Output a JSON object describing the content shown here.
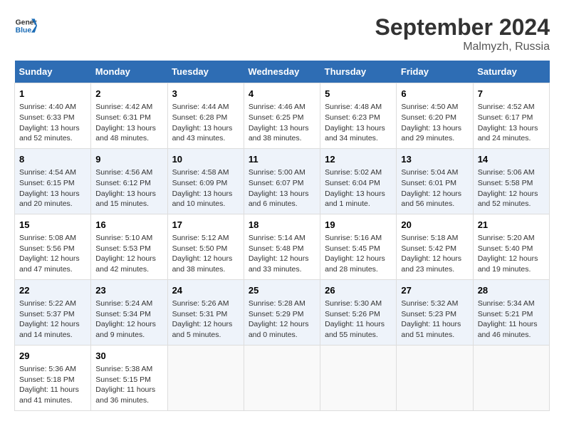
{
  "header": {
    "logo_line1": "General",
    "logo_line2": "Blue",
    "month": "September 2024",
    "location": "Malmyzh, Russia"
  },
  "weekdays": [
    "Sunday",
    "Monday",
    "Tuesday",
    "Wednesday",
    "Thursday",
    "Friday",
    "Saturday"
  ],
  "weeks": [
    [
      {
        "day": "1",
        "info": "Sunrise: 4:40 AM\nSunset: 6:33 PM\nDaylight: 13 hours\nand 52 minutes."
      },
      {
        "day": "2",
        "info": "Sunrise: 4:42 AM\nSunset: 6:31 PM\nDaylight: 13 hours\nand 48 minutes."
      },
      {
        "day": "3",
        "info": "Sunrise: 4:44 AM\nSunset: 6:28 PM\nDaylight: 13 hours\nand 43 minutes."
      },
      {
        "day": "4",
        "info": "Sunrise: 4:46 AM\nSunset: 6:25 PM\nDaylight: 13 hours\nand 38 minutes."
      },
      {
        "day": "5",
        "info": "Sunrise: 4:48 AM\nSunset: 6:23 PM\nDaylight: 13 hours\nand 34 minutes."
      },
      {
        "day": "6",
        "info": "Sunrise: 4:50 AM\nSunset: 6:20 PM\nDaylight: 13 hours\nand 29 minutes."
      },
      {
        "day": "7",
        "info": "Sunrise: 4:52 AM\nSunset: 6:17 PM\nDaylight: 13 hours\nand 24 minutes."
      }
    ],
    [
      {
        "day": "8",
        "info": "Sunrise: 4:54 AM\nSunset: 6:15 PM\nDaylight: 13 hours\nand 20 minutes."
      },
      {
        "day": "9",
        "info": "Sunrise: 4:56 AM\nSunset: 6:12 PM\nDaylight: 13 hours\nand 15 minutes."
      },
      {
        "day": "10",
        "info": "Sunrise: 4:58 AM\nSunset: 6:09 PM\nDaylight: 13 hours\nand 10 minutes."
      },
      {
        "day": "11",
        "info": "Sunrise: 5:00 AM\nSunset: 6:07 PM\nDaylight: 13 hours\nand 6 minutes."
      },
      {
        "day": "12",
        "info": "Sunrise: 5:02 AM\nSunset: 6:04 PM\nDaylight: 13 hours\nand 1 minute."
      },
      {
        "day": "13",
        "info": "Sunrise: 5:04 AM\nSunset: 6:01 PM\nDaylight: 12 hours\nand 56 minutes."
      },
      {
        "day": "14",
        "info": "Sunrise: 5:06 AM\nSunset: 5:58 PM\nDaylight: 12 hours\nand 52 minutes."
      }
    ],
    [
      {
        "day": "15",
        "info": "Sunrise: 5:08 AM\nSunset: 5:56 PM\nDaylight: 12 hours\nand 47 minutes."
      },
      {
        "day": "16",
        "info": "Sunrise: 5:10 AM\nSunset: 5:53 PM\nDaylight: 12 hours\nand 42 minutes."
      },
      {
        "day": "17",
        "info": "Sunrise: 5:12 AM\nSunset: 5:50 PM\nDaylight: 12 hours\nand 38 minutes."
      },
      {
        "day": "18",
        "info": "Sunrise: 5:14 AM\nSunset: 5:48 PM\nDaylight: 12 hours\nand 33 minutes."
      },
      {
        "day": "19",
        "info": "Sunrise: 5:16 AM\nSunset: 5:45 PM\nDaylight: 12 hours\nand 28 minutes."
      },
      {
        "day": "20",
        "info": "Sunrise: 5:18 AM\nSunset: 5:42 PM\nDaylight: 12 hours\nand 23 minutes."
      },
      {
        "day": "21",
        "info": "Sunrise: 5:20 AM\nSunset: 5:40 PM\nDaylight: 12 hours\nand 19 minutes."
      }
    ],
    [
      {
        "day": "22",
        "info": "Sunrise: 5:22 AM\nSunset: 5:37 PM\nDaylight: 12 hours\nand 14 minutes."
      },
      {
        "day": "23",
        "info": "Sunrise: 5:24 AM\nSunset: 5:34 PM\nDaylight: 12 hours\nand 9 minutes."
      },
      {
        "day": "24",
        "info": "Sunrise: 5:26 AM\nSunset: 5:31 PM\nDaylight: 12 hours\nand 5 minutes."
      },
      {
        "day": "25",
        "info": "Sunrise: 5:28 AM\nSunset: 5:29 PM\nDaylight: 12 hours\nand 0 minutes."
      },
      {
        "day": "26",
        "info": "Sunrise: 5:30 AM\nSunset: 5:26 PM\nDaylight: 11 hours\nand 55 minutes."
      },
      {
        "day": "27",
        "info": "Sunrise: 5:32 AM\nSunset: 5:23 PM\nDaylight: 11 hours\nand 51 minutes."
      },
      {
        "day": "28",
        "info": "Sunrise: 5:34 AM\nSunset: 5:21 PM\nDaylight: 11 hours\nand 46 minutes."
      }
    ],
    [
      {
        "day": "29",
        "info": "Sunrise: 5:36 AM\nSunset: 5:18 PM\nDaylight: 11 hours\nand 41 minutes."
      },
      {
        "day": "30",
        "info": "Sunrise: 5:38 AM\nSunset: 5:15 PM\nDaylight: 11 hours\nand 36 minutes."
      },
      {
        "day": "",
        "info": ""
      },
      {
        "day": "",
        "info": ""
      },
      {
        "day": "",
        "info": ""
      },
      {
        "day": "",
        "info": ""
      },
      {
        "day": "",
        "info": ""
      }
    ]
  ]
}
